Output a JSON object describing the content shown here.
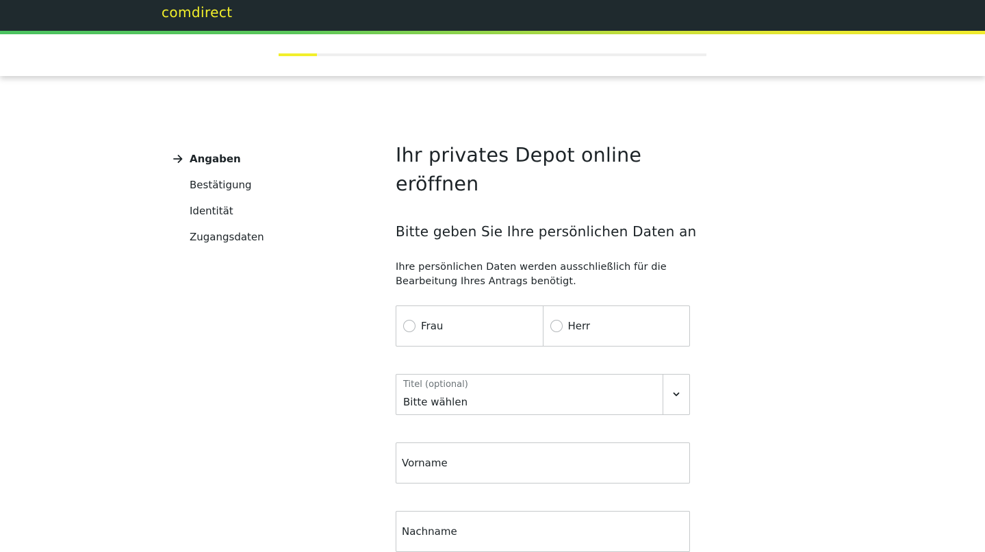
{
  "header": {
    "brand": "comdirect"
  },
  "progress": {
    "value_fraction": 0.09
  },
  "steps": [
    {
      "label": "Angaben",
      "active": true
    },
    {
      "label": "Bestätigung",
      "active": false
    },
    {
      "label": "Identität",
      "active": false
    },
    {
      "label": "Zugangsdaten",
      "active": false
    }
  ],
  "main": {
    "title": "Ihr privates Depot online eröffnen",
    "subtitle": "Bitte geben Sie Ihre persönlichen Daten an",
    "intro": "Ihre persönlichen Daten werden ausschließlich für die Bearbeitung Ihres Antrags benötigt.",
    "salutation_options": [
      "Frau",
      "Herr"
    ],
    "title_select": {
      "label": "Titel (optional)",
      "value": "Bitte wählen"
    },
    "firstname_placeholder": "Vorname",
    "lastname_placeholder": "Nachname"
  },
  "colors": {
    "header_bg": "#1f2a2e",
    "brand": "#f2ef2b",
    "progress_fill": "#f2ef2b",
    "border": "#c6c9cb"
  },
  "icons": {
    "active_step": "arrow-right-icon",
    "select": "chevron-down-icon",
    "radio": "radio-circle-icon"
  }
}
